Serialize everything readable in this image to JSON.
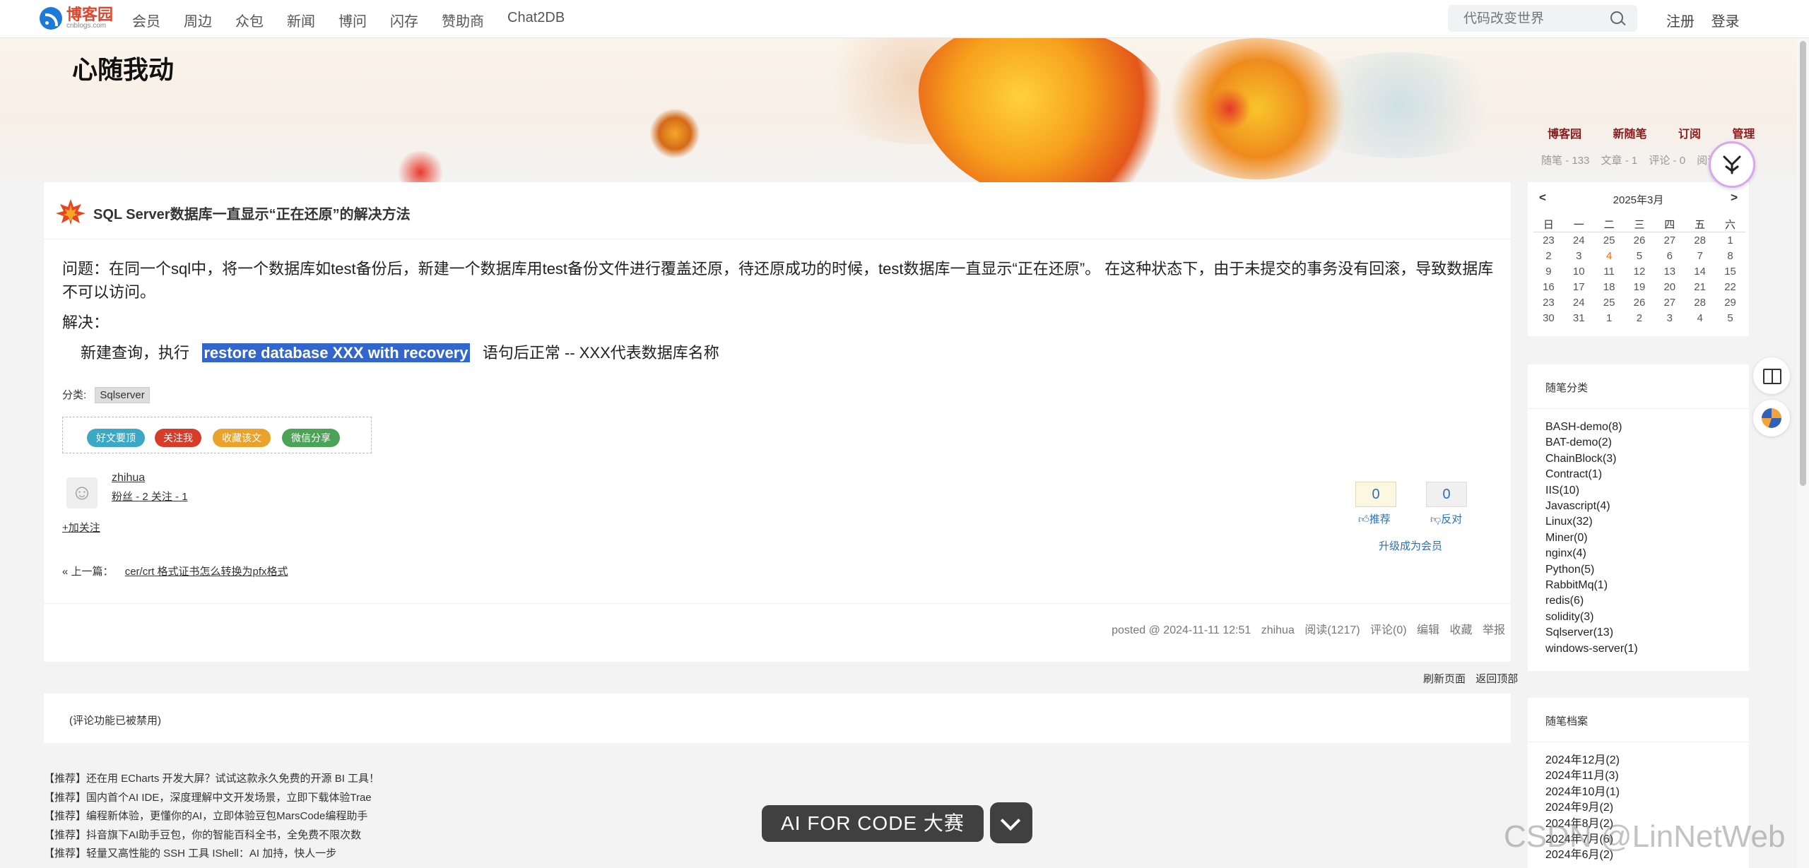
{
  "topnav": {
    "logo_cn": "博客园",
    "logo_en": "cnblogs.com",
    "links": [
      "会员",
      "周边",
      "众包",
      "新闻",
      "博问",
      "闪存",
      "赞助商",
      "Chat2DB"
    ],
    "search_placeholder": "代码改变世界",
    "register": "注册",
    "login": "登录"
  },
  "blog": {
    "title": "心随我动",
    "nav": [
      "博客园",
      "新随笔",
      "订阅",
      "管理"
    ],
    "stats": [
      "随笔 - 133",
      "文章 - 1",
      "评论 - 0",
      "阅读"
    ]
  },
  "post": {
    "title": "SQL Server数据库一直显示“正在还原”的解决方法",
    "problem": "问题：在同一个sql中，将一个数据库如test备份后，新建一个数据库用test备份文件进行覆盖还原，待还原成功的时候，test数据库一直显示“正在还原”。 在这种状态下，由于未提交的事务没有回滚，导致数据库不可以访问。",
    "solution_label": "解决：",
    "step_prefix": "新建查询，执行",
    "step_code": "restore database XXX with recovery",
    "step_suffix": "语句后正常 -- XXX代表数据库名称",
    "category_label": "分类:",
    "category": "Sqlserver",
    "share_buttons": [
      {
        "label": "好文要顶",
        "color": "#3ba8c5"
      },
      {
        "label": "关注我",
        "color": "#d63c2a"
      },
      {
        "label": "收藏该文",
        "color": "#e9a32d"
      },
      {
        "label": "微信分享",
        "color": "#4ba357"
      }
    ],
    "author": "zhihua",
    "author_fans": "粉丝 - 2",
    "author_follow": "关注 - 1",
    "follow_link": "+加关注",
    "recommend_count": "0",
    "oppose_count": "0",
    "recommend_label": "推荐",
    "oppose_label": "反对",
    "upgrade": "升级成为会员",
    "prev_label": "« 上一篇：",
    "prev_title": "cer/crt 格式证书怎么转换为pfx格式",
    "meta": {
      "posted": "posted @ 2024-11-11 12:51",
      "author": "zhihua",
      "views": "阅读(1217)",
      "comments": "评论(0)",
      "edit": "编辑",
      "favorite": "收藏",
      "report": "举报"
    }
  },
  "page_links": {
    "refresh": "刷新页面",
    "top": "返回顶部"
  },
  "comments_disabled": "(评论功能已被禁用)",
  "promos": [
    "【推荐】还在用 ECharts 开发大屏？试试这款永久免费的开源 BI 工具！",
    "【推荐】国内首个AI IDE，深度理解中文开发场景，立即下载体验Trae",
    "【推荐】编程新体验，更懂你的AI，立即体验豆包MarsCode编程助手",
    "【推荐】抖音旗下AI助手豆包，你的智能百科全书，全免费不限次数",
    "【推荐】轻量又高性能的 SSH 工具 IShell：AI 加持，快人一步"
  ],
  "calendar": {
    "prev": "<",
    "next": ">",
    "month": "2025年3月",
    "weekdays": [
      "日",
      "一",
      "二",
      "三",
      "四",
      "五",
      "六"
    ],
    "weeks": [
      [
        "23",
        "24",
        "25",
        "26",
        "27",
        "28",
        "1"
      ],
      [
        "2",
        "3",
        "4",
        "5",
        "6",
        "7",
        "8"
      ],
      [
        "9",
        "10",
        "11",
        "12",
        "13",
        "14",
        "15"
      ],
      [
        "16",
        "17",
        "18",
        "19",
        "20",
        "21",
        "22"
      ],
      [
        "23",
        "24",
        "25",
        "26",
        "27",
        "28",
        "29"
      ],
      [
        "30",
        "31",
        "1",
        "2",
        "3",
        "4",
        "5"
      ]
    ],
    "today": "4"
  },
  "categories": {
    "title": "随笔分类",
    "items": [
      "BASH-demo(8)",
      "BAT-demo(2)",
      "ChainBlock(3)",
      "Contract(1)",
      "IIS(10)",
      "Javascript(4)",
      "Linux(32)",
      "Miner(0)",
      "nginx(4)",
      "Python(5)",
      "RabbitMq(1)",
      "redis(6)",
      "solidity(3)",
      "Sqlserver(13)",
      "windows-server(1)"
    ]
  },
  "archive": {
    "title": "随笔档案",
    "items": [
      "2024年12月(2)",
      "2024年11月(3)",
      "2024年10月(1)",
      "2024年9月(2)",
      "2024年8月(2)",
      "2024年7月(6)",
      "2024年6月(2)"
    ]
  },
  "ai_banner": "AI FOR CODE 大赛",
  "watermark": "CSDN @LinNetWeb"
}
